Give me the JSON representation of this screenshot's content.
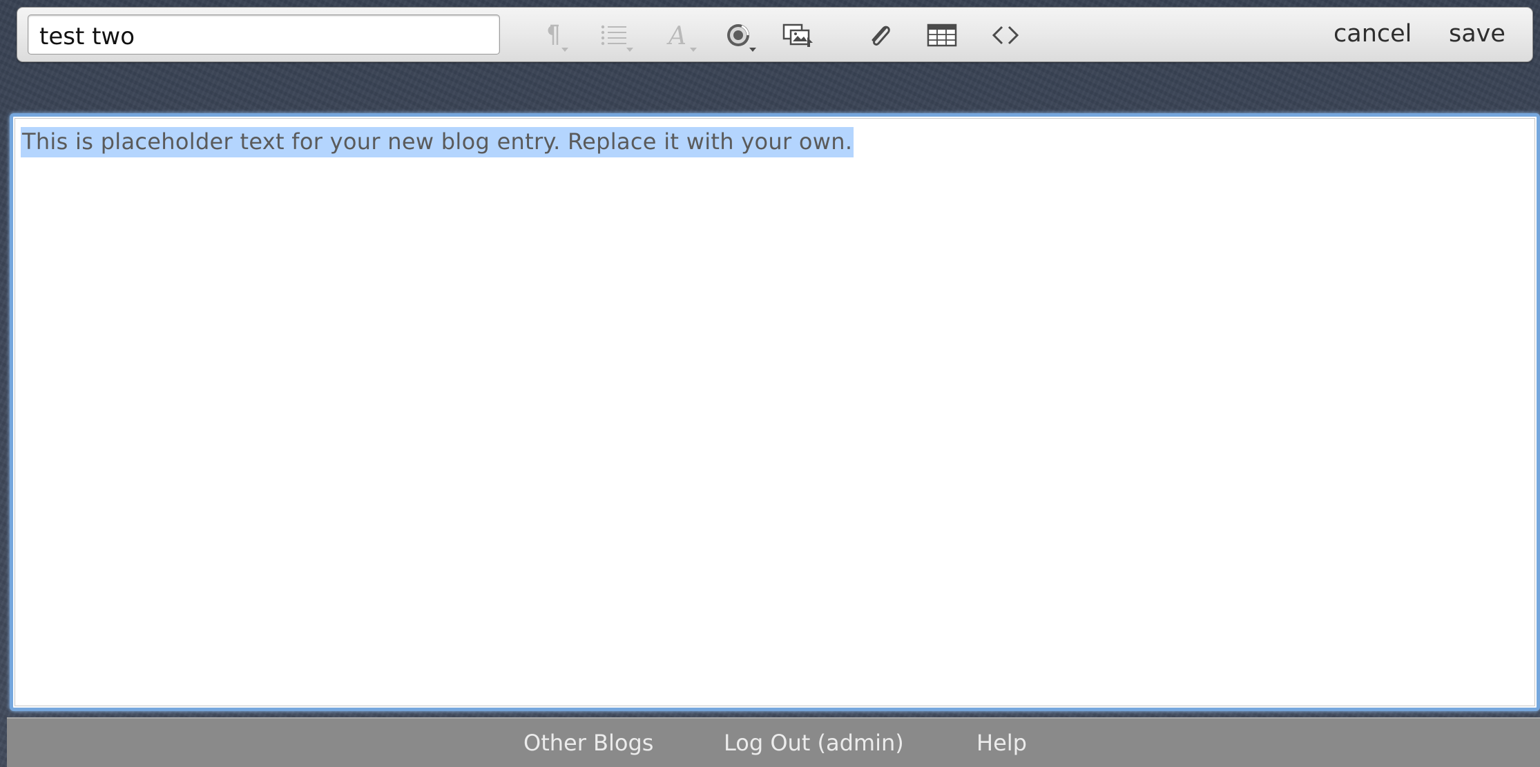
{
  "toolbar": {
    "title_value": "test two",
    "cancel_label": "cancel",
    "save_label": "save",
    "icons": [
      "paragraph-format-icon",
      "list-icon",
      "font-style-icon",
      "link-icon",
      "insert-image-icon",
      "attachment-icon",
      "table-icon",
      "html-source-icon"
    ]
  },
  "editor": {
    "content": "This is placeholder text for your new blog entry. Replace it with your own."
  },
  "footer": {
    "links": [
      {
        "label": "Other Blogs"
      },
      {
        "label": "Log Out (admin)"
      },
      {
        "label": "Help"
      }
    ]
  },
  "colors": {
    "selection": "#b4d5fe",
    "focus_ring": "#76a7dd",
    "footer_bg": "#8a8a8a"
  }
}
